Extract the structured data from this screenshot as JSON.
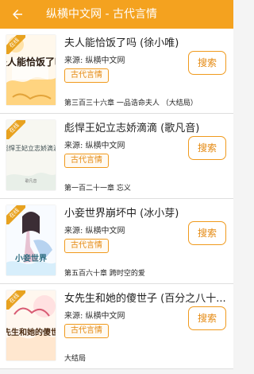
{
  "header": {
    "title": "纵横中文网 - 古代言情",
    "back_icon": "arrow-left-icon"
  },
  "colors": {
    "accent": "#f4a21f",
    "accent_text": "#e58a12",
    "background": "#f4f4f4"
  },
  "books": [
    {
      "title": "夫人能恰饭了吗 (徐小唯)",
      "source": "来源: 纵横中文网",
      "category": "古代言情",
      "latest_chapter": "第三百三十六章 一品诰命夫人 （大结局）",
      "action": "搜索",
      "cover_badge": "在线",
      "cover_text": "夫人能恰饭了吗"
    },
    {
      "title": "彪悍王妃立志娇滴滴 (歌凡音)",
      "source": "来源: 纵横中文网",
      "category": "古代言情",
      "latest_chapter": "第一百二十一章 忘义",
      "action": "搜索",
      "cover_badge": "在线",
      "cover_text": "彪悍王妃立志娇滴滴",
      "cover_author": "歌凡音"
    },
    {
      "title": "小妾世界崩坏中 (冰小芽)",
      "source": "来源: 纵横中文网",
      "category": "古代言情",
      "latest_chapter": "第五百六十章 跨时空的爱",
      "action": "搜索",
      "cover_badge": "在线",
      "cover_text": "小妾世界"
    },
    {
      "title": "女先生和她的傻世子 (百分之八十...",
      "source": "来源: 纵横中文网",
      "category": "古代言情",
      "latest_chapter": "大结局",
      "action": "搜索",
      "cover_badge": "在线",
      "cover_text": "女先生和她的傻世子"
    }
  ]
}
